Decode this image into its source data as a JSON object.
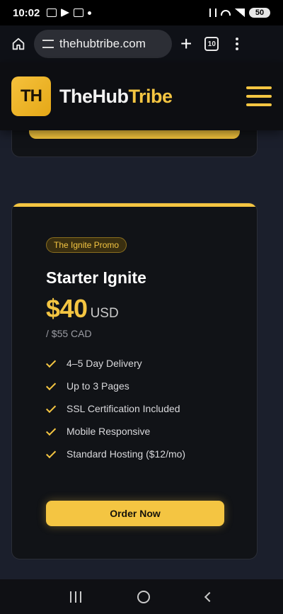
{
  "status_bar": {
    "time": "10:02",
    "battery": "50",
    "left_icons": [
      "screen-record-icon",
      "telegram-icon",
      "gmail-icon",
      "dot-icon"
    ],
    "right_icons": [
      "mute-icon",
      "wifi-icon",
      "signal-icon",
      "battery-icon"
    ]
  },
  "browser": {
    "url": "thehubtribe.com",
    "tab_count": "10"
  },
  "site": {
    "logo_mark": "TH",
    "logo_text_1": "TheHub",
    "logo_text_2": "Tribe",
    "accent_color": "#f4c542"
  },
  "card": {
    "badge": "The Ignite Promo",
    "title": "Starter Ignite",
    "price": "$40",
    "currency": "USD",
    "alt_price": "/ $55 CAD",
    "features": [
      "4–5 Day Delivery",
      "Up to 3 Pages",
      "SSL Certification Included",
      "Mobile Responsive",
      "Standard Hosting ($12/mo)"
    ],
    "cta": "Order Now"
  }
}
